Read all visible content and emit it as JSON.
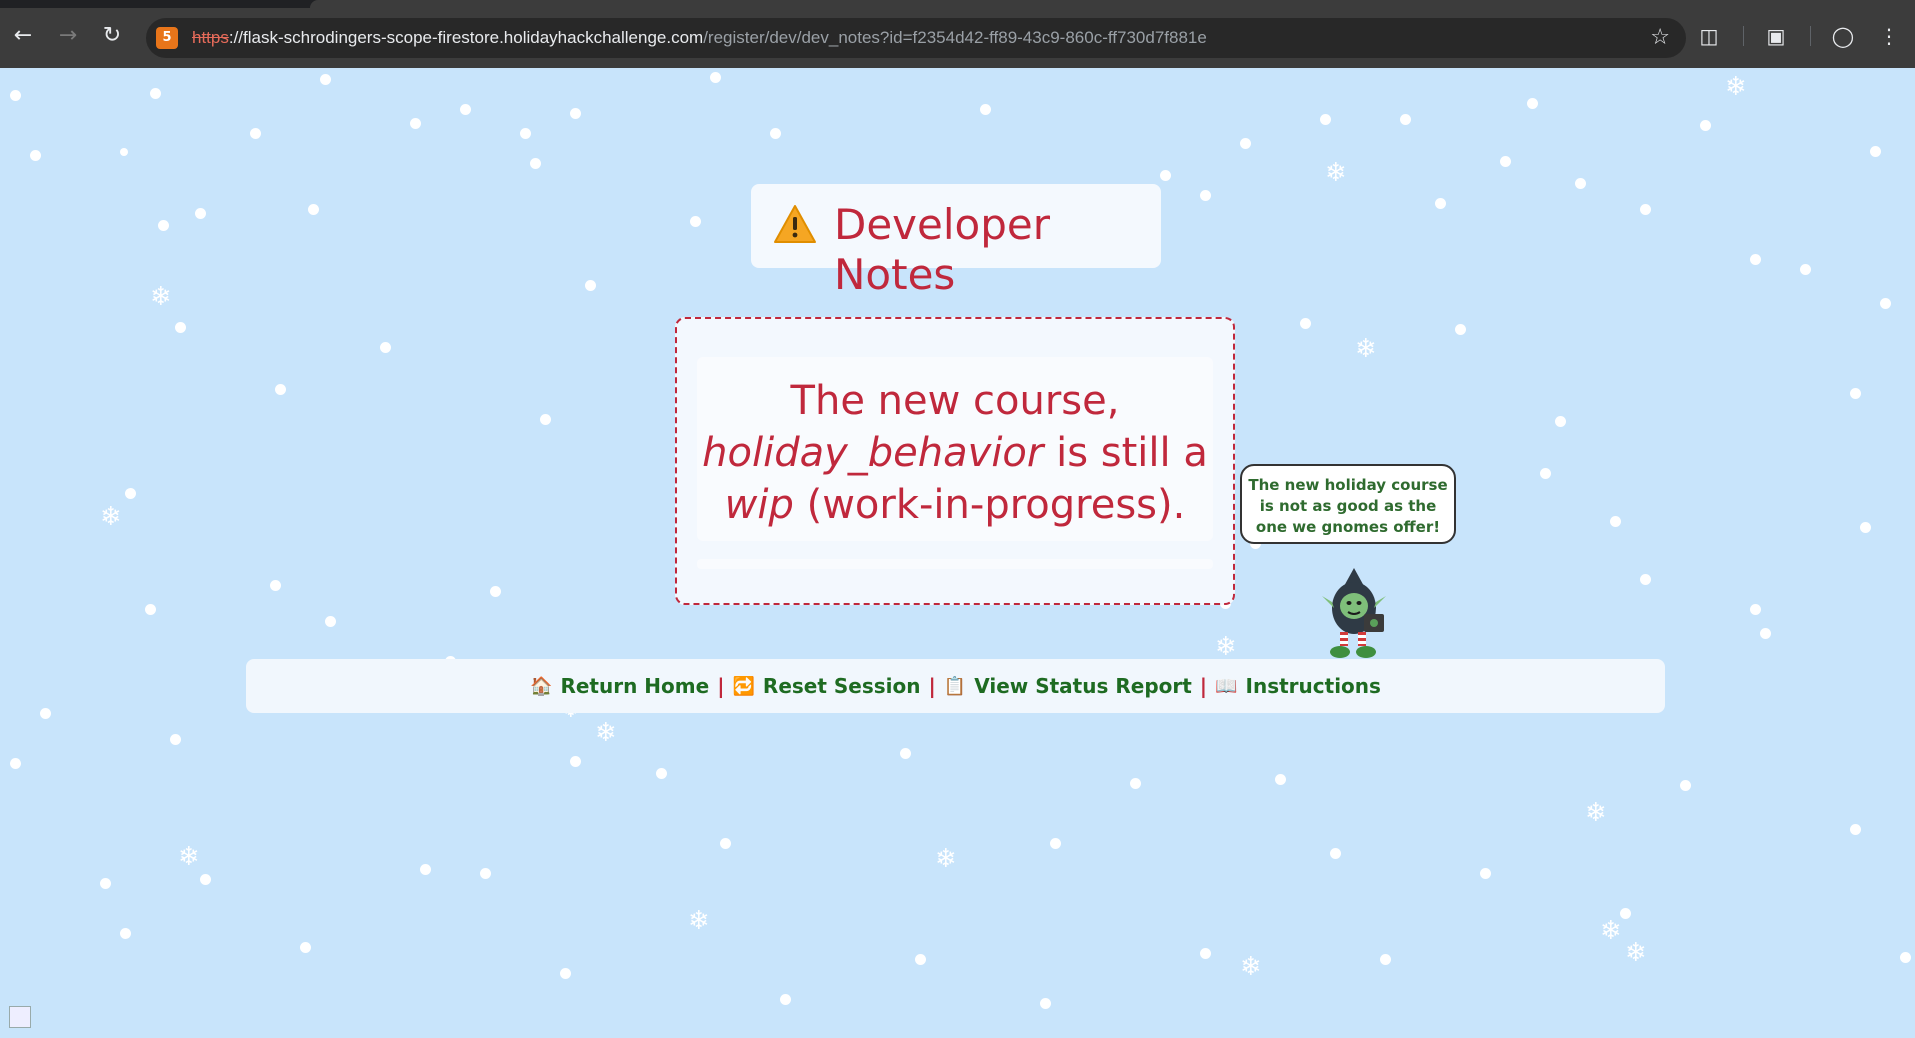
{
  "browser": {
    "url_scheme": "https",
    "url_host": "://flask-schrodingers-scope-firestore.holidayhackchallenge.com",
    "url_path": "/register/dev/dev_notes?id=f2354d42-ff89-43c9-860c-ff730d7f881e"
  },
  "page": {
    "title": "Developer Notes",
    "note_part1": "The new course,",
    "note_em": "holiday_behavior",
    "note_part2": " is still a",
    "note_line3_em": "wip",
    "note_line3": " (work-in-progress).",
    "bubble_text": "The new holiday course is not as good as the one we gnomes offer!"
  },
  "nav": {
    "home_label": "Return Home",
    "reset_label": "Reset Session",
    "status_label": "View Status Report",
    "instructions_label": "Instructions",
    "separator": "|"
  },
  "colors": {
    "background": "#c8e4fb",
    "accent_red": "#c0283c",
    "link_green": "#1e6b22"
  }
}
